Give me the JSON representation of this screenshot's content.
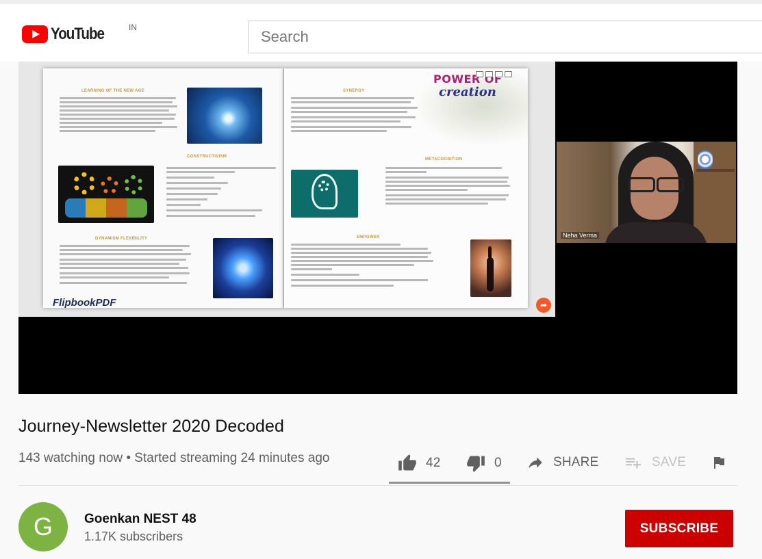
{
  "header": {
    "logo_text": "YouTube",
    "country": "IN",
    "search_placeholder": "Search"
  },
  "player": {
    "flipbook_brand": "FlipbookPDF",
    "book_heading_line1": "POWER OF",
    "book_heading_line2": "creation",
    "participant_name": "Neha Verma"
  },
  "video": {
    "title": "Journey-Newsletter 2020 Decoded",
    "meta": "143 watching now • Started streaming 24 minutes ago"
  },
  "actions": {
    "likes": "42",
    "dislikes": "0",
    "share_label": "SHARE",
    "save_label": "SAVE",
    "like_ratio": 1.0
  },
  "channel": {
    "avatar_letter": "G",
    "name": "Goenkan NEST 48",
    "subscribers": "1.17K subscribers",
    "subscribe_label": "SUBSCRIBE"
  },
  "colors": {
    "brand_red": "#ff0000",
    "subscribe_red": "#cc0000",
    "avatar_green": "#7cb342"
  }
}
